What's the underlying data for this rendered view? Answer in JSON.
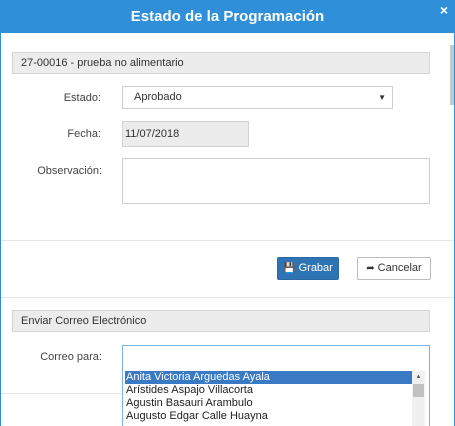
{
  "dialog": {
    "title": "Estado de la Programación",
    "close_icon": "×"
  },
  "program": {
    "section_label": "27-00016 - prueba no alimentario"
  },
  "form": {
    "estado_label": "Estado:",
    "estado_value": "Aprobado",
    "fecha_label": "Fecha:",
    "fecha_value": "11/07/2018",
    "observacion_label": "Observación:",
    "observacion_value": ""
  },
  "buttons": {
    "save_label": "Grabar",
    "cancel_label": "Cancelar",
    "save_icon": "floppy-disk-icon",
    "cancel_icon": "reply-arrow-icon"
  },
  "email": {
    "section_label": "Enviar Correo Electrónico",
    "to_label": "Correo para:",
    "recipients": [
      "Anita Victoria Arguedas Ayala",
      "Arístides Aspajo Villacorta",
      "Agustin Basauri Arambulo",
      "Augusto Edgar Calle Huayna"
    ],
    "selected_index": 0
  },
  "colors": {
    "header": "#2f8fd8",
    "primary_button": "#2e74b5",
    "selected_item": "#3a79c4"
  }
}
